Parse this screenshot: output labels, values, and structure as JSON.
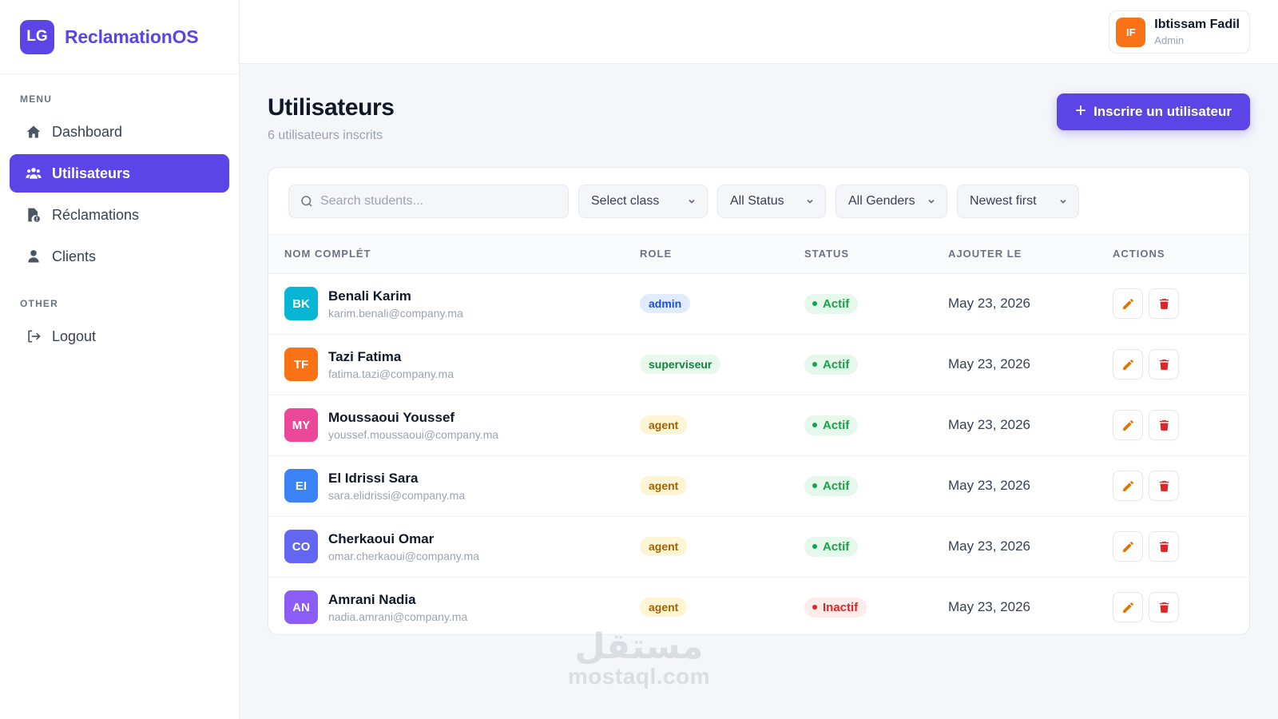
{
  "brand": {
    "logo": "LG",
    "name": "ReclamationOS"
  },
  "sidebar": {
    "menu_title": "MENU",
    "items": [
      {
        "label": "Dashboard",
        "icon": "home-icon",
        "active": false
      },
      {
        "label": "Utilisateurs",
        "icon": "users-icon",
        "active": true
      },
      {
        "label": "Réclamations",
        "icon": "file-icon",
        "active": false
      },
      {
        "label": "Clients",
        "icon": "user-icon",
        "active": false
      }
    ],
    "other_title": "OTHER",
    "logout_label": "Logout"
  },
  "user": {
    "initials": "IF",
    "name": "Ibtissam Fadil",
    "role": "Admin",
    "avatar_color": "#f97316"
  },
  "header": {
    "title": "Utilisateurs",
    "subtitle": "6 utilisateurs inscrits",
    "add_button": "Inscrire un utilisateur"
  },
  "filters": {
    "search_placeholder": "Search students...",
    "class": "Select class",
    "status": "All Status",
    "gender": "All Genders",
    "sort": "Newest first"
  },
  "table": {
    "columns": [
      "NOM COMPLÉT",
      "ROLE",
      "STATUS",
      "AJOUTER LE",
      "ACTIONS"
    ],
    "rows": [
      {
        "initials": "BK",
        "avatar_color": "#06b6d4",
        "name": "Benali Karim",
        "email": "karim.benali@company.ma",
        "role": "admin",
        "status": "Actif",
        "date": "May 23, 2026"
      },
      {
        "initials": "TF",
        "avatar_color": "#f97316",
        "name": "Tazi Fatima",
        "email": "fatima.tazi@company.ma",
        "role": "superviseur",
        "status": "Actif",
        "date": "May 23, 2026"
      },
      {
        "initials": "MY",
        "avatar_color": "#ec4899",
        "name": "Moussaoui Youssef",
        "email": "youssef.moussaoui@company.ma",
        "role": "agent",
        "status": "Actif",
        "date": "May 23, 2026"
      },
      {
        "initials": "EI",
        "avatar_color": "#3b82f6",
        "name": "El Idrissi Sara",
        "email": "sara.elidrissi@company.ma",
        "role": "agent",
        "status": "Actif",
        "date": "May 23, 2026"
      },
      {
        "initials": "CO",
        "avatar_color": "#6366f1",
        "name": "Cherkaoui Omar",
        "email": "omar.cherkaoui@company.ma",
        "role": "agent",
        "status": "Actif",
        "date": "May 23, 2026"
      },
      {
        "initials": "AN",
        "avatar_color": "#8b5cf6",
        "name": "Amrani Nadia",
        "email": "nadia.amrani@company.ma",
        "role": "agent",
        "status": "Inactif",
        "date": "May 23, 2026"
      }
    ]
  },
  "colors": {
    "accent": "#5b45e6",
    "role_admin_bg": "#e0ecfd",
    "role_admin_fg": "#1d4ed8",
    "role_superviseur_bg": "#e8f8ec",
    "role_superviseur_fg": "#15803d",
    "role_agent_bg": "#fdf5d3",
    "role_agent_fg": "#a16207",
    "status_active_bg": "#e6f7ec",
    "status_active_fg": "#16a34a",
    "status_inactive_bg": "#fdecec",
    "status_inactive_fg": "#dc2626"
  },
  "watermark": {
    "arabic": "مستقل",
    "latin": "mostaql.com"
  }
}
